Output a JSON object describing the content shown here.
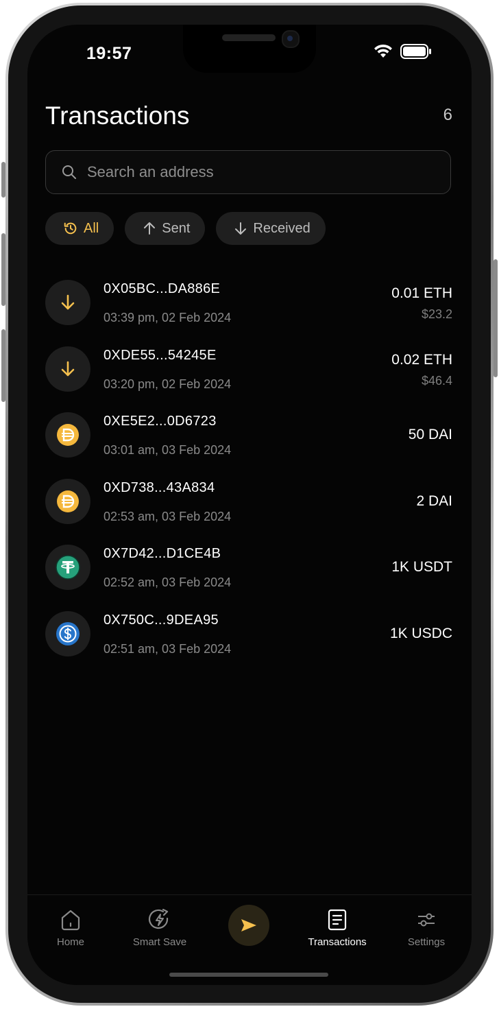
{
  "status_bar": {
    "time": "19:57"
  },
  "header": {
    "title": "Transactions",
    "count": "6"
  },
  "search": {
    "placeholder": "Search an address"
  },
  "filters": [
    {
      "label": "All",
      "icon": "history-icon",
      "active": true
    },
    {
      "label": "Sent",
      "icon": "arrow-up-icon",
      "active": false
    },
    {
      "label": "Received",
      "icon": "arrow-down-icon",
      "active": false
    }
  ],
  "transactions": [
    {
      "address": "0X05BC...DA886E",
      "time": "03:39 pm,  02 Feb 2024",
      "amount": "0.01 ETH",
      "fiat": "$23.2",
      "icon": "receive-arrow-icon"
    },
    {
      "address": "0XDE55...54245E",
      "time": "03:20 pm,  02 Feb 2024",
      "amount": "0.02 ETH",
      "fiat": "$46.4",
      "icon": "receive-arrow-icon"
    },
    {
      "address": "0XE5E2...0D6723",
      "time": "03:01 am,  03 Feb 2024",
      "amount": "50 DAI",
      "fiat": "",
      "icon": "dai-token-icon"
    },
    {
      "address": "0XD738...43A834",
      "time": "02:53 am,  03 Feb 2024",
      "amount": "2 DAI",
      "fiat": "",
      "icon": "dai-token-icon"
    },
    {
      "address": "0X7D42...D1CE4B",
      "time": "02:52 am,  03 Feb 2024",
      "amount": "1K USDT",
      "fiat": "",
      "icon": "usdt-token-icon"
    },
    {
      "address": "0X750C...9DEA95",
      "time": "02:51 am,  03 Feb 2024",
      "amount": "1K USDC",
      "fiat": "",
      "icon": "usdc-token-icon"
    }
  ],
  "tabbar": {
    "home": "Home",
    "smart_save": "Smart Save",
    "transactions": "Transactions",
    "settings": "Settings"
  },
  "colors": {
    "accent": "#f5c04e",
    "background": "#050505",
    "chip": "#1f1f1f",
    "usdt": "#26a17b",
    "usdc": "#2775ca"
  }
}
